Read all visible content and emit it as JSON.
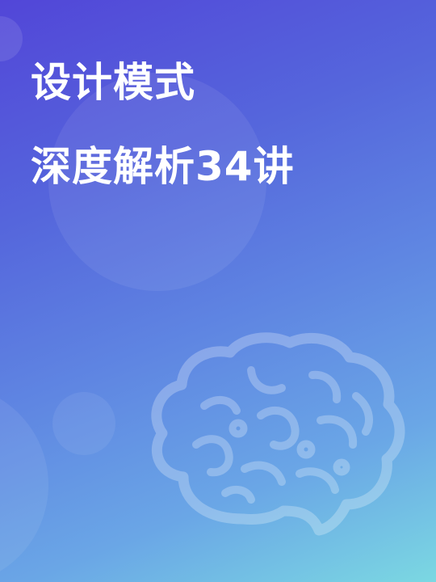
{
  "cover": {
    "title_line1": "设计模式",
    "title_line2": "深度解析34讲",
    "illustration_icon": "brain-icon",
    "colors": {
      "gradient_start": "#5246d8",
      "gradient_end": "#7bd8e2",
      "title": "#ffffff"
    }
  }
}
